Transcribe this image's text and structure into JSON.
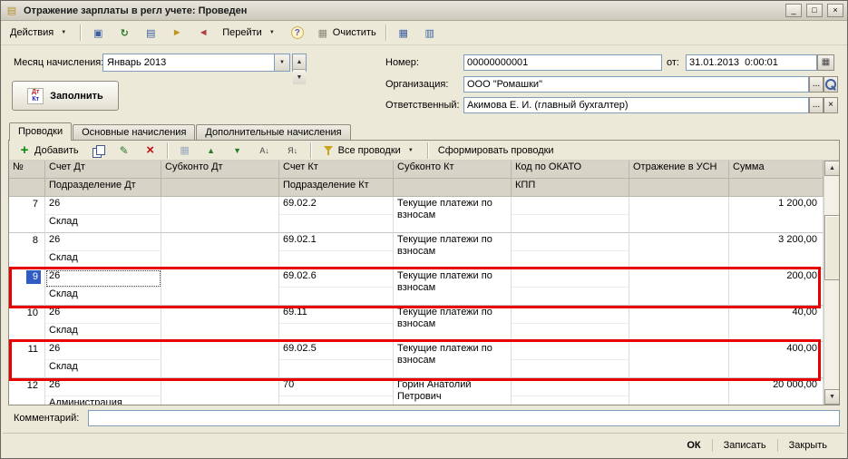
{
  "window": {
    "title": "Отражение зарплаты в регл учете: Проведен",
    "minimize": "_",
    "maximize": "□",
    "close": "×"
  },
  "toolbar": {
    "actions": "Действия",
    "go": "Перейти",
    "help": "?",
    "clear": "Очистить"
  },
  "form": {
    "month_label": "Месяц начисления:",
    "month_value": "Январь 2013",
    "number_label": "Номер:",
    "number_value": "00000000001",
    "date_label": "от:",
    "date_value": "31.01.2013  0:00:01",
    "org_label": "Организация:",
    "org_value": "ООО \"Ромашки\"",
    "responsible_label": "Ответственный:",
    "responsible_value": "Акимова Е. И. (главный бухгалтер)",
    "fill_button": "Заполнить",
    "lookup_button": "...",
    "clear_button": "×"
  },
  "tabs": [
    {
      "label": "Проводки",
      "active": true
    },
    {
      "label": "Основные начисления",
      "active": false
    },
    {
      "label": "Дополнительные начисления",
      "active": false
    }
  ],
  "grid_toolbar": {
    "add": "Добавить",
    "all_postings": "Все проводки",
    "generate": "Сформировать проводки",
    "sort_asc": "А↓",
    "sort_desc": "Я↓"
  },
  "table": {
    "headers": {
      "num": "№",
      "debit_account": "Счет Дт",
      "debit_subdivision": "Подразделение Дт",
      "debit_subconto": "Субконто Дт",
      "credit_account": "Счет Кт",
      "credit_subdivision": "Подразделение Кт",
      "credit_subconto": "Субконто Кт",
      "okato": "Код по ОКАТО",
      "kpp": "КПП",
      "usn": "Отражение в УСН",
      "sum": "Сумма"
    },
    "rows": [
      {
        "num": "7",
        "debit_account": "26",
        "debit_subdivision": "Склад",
        "credit_account": "69.02.2",
        "credit_subconto": "Текущие платежи по взносам",
        "sum": "1 200,00",
        "selected": false,
        "highlighted": false
      },
      {
        "num": "8",
        "debit_account": "26",
        "debit_subdivision": "Склад",
        "credit_account": "69.02.1",
        "credit_subconto": "Текущие платежи по взносам",
        "sum": "3 200,00",
        "selected": false,
        "highlighted": false
      },
      {
        "num": "9",
        "debit_account": "26",
        "debit_subdivision": "Склад",
        "credit_account": "69.02.6",
        "credit_subconto": "Текущие платежи по взносам",
        "sum": "200,00",
        "selected": true,
        "highlighted": true
      },
      {
        "num": "10",
        "debit_account": "26",
        "debit_subdivision": "Склад",
        "credit_account": "69.11",
        "credit_subconto": "Текущие платежи по взносам",
        "sum": "40,00",
        "selected": false,
        "highlighted": false
      },
      {
        "num": "11",
        "debit_account": "26",
        "debit_subdivision": "Склад",
        "credit_account": "69.02.5",
        "credit_subconto": "Текущие платежи по взносам",
        "sum": "400,00",
        "selected": false,
        "highlighted": true
      },
      {
        "num": "12",
        "debit_account": "26",
        "debit_subdivision": "Администрация",
        "credit_account": "70",
        "credit_subconto": "Горин Анатолий Петрович",
        "sum": "20 000,00",
        "selected": false,
        "highlighted": false
      }
    ]
  },
  "comment": {
    "label": "Комментарий:",
    "value": ""
  },
  "footer": {
    "ok": "ОК",
    "save": "Записать",
    "close": "Закрыть"
  },
  "colors": {
    "selection": "#2f5bc4",
    "annotation": "#e80000",
    "window_bg": "#ece9d8"
  },
  "icons": {
    "window-icon": "▤",
    "save-icon": "▣",
    "reread-icon": "↻",
    "copy-document-icon": "▤",
    "post-icon": "►",
    "unpost-icon": "◄",
    "help-icon": "?",
    "clear-icon": "▦",
    "structure-icon": "▦",
    "list-settings-icon": "▥",
    "add-icon": "+",
    "copy-row-icon": "css:two-sheets",
    "edit-icon": "✎",
    "delete-icon": "×",
    "move-up-icon": "▲",
    "move-down-icon": "▼",
    "funnel-icon": "css:funnel",
    "calendar-icon": "▦",
    "magnifier-icon": "css:magnifier",
    "dropdown-arrow-icon": "▼",
    "dtkt-icon": "Дт/Кт",
    "scroll-up-icon": "▲",
    "scroll-down-icon": "▼"
  }
}
